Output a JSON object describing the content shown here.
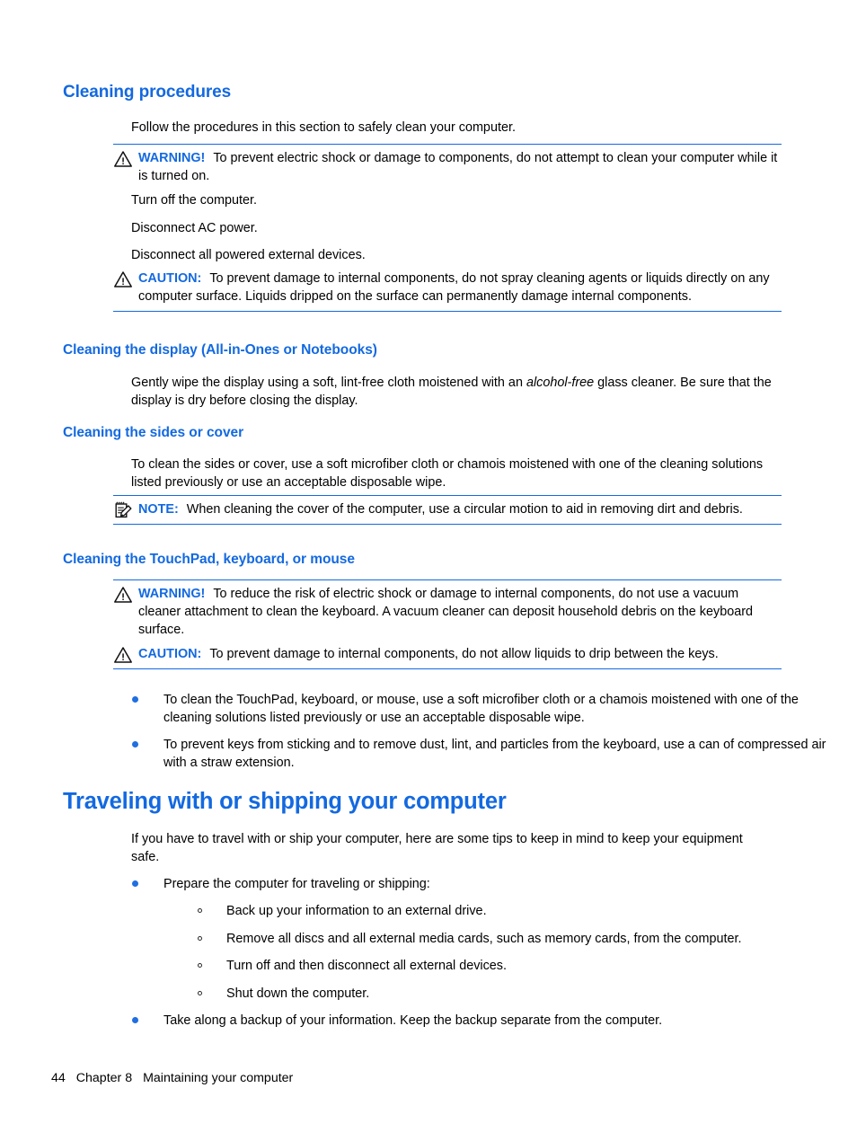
{
  "document": {
    "section_title": "Cleaning procedures",
    "intro": "Follow the procedures in this section to safely clean your computer.",
    "steps": [
      "Turn off the computer.",
      "Disconnect AC power.",
      "Disconnect all powered external devices."
    ],
    "admonitions": {
      "warning_clean": {
        "label": "WARNING!",
        "icon": "warning-triangle-icon",
        "text": "To prevent electric shock or damage to components, do not attempt to clean your computer while it is turned on."
      },
      "caution_spray": {
        "label": "CAUTION:",
        "icon": "caution-triangle-icon",
        "text": "To prevent damage to internal components, do not spray cleaning agents or liquids directly on any computer surface. Liquids dripped on the surface can permanently damage internal components."
      },
      "note_cover": {
        "label": "NOTE:",
        "icon": "note-pad-icon",
        "text": "When cleaning the cover of the computer, use a circular motion to aid in removing dirt and debris."
      },
      "warning_vacuum": {
        "label": "WARNING!",
        "icon": "warning-triangle-icon",
        "text": "To reduce the risk of electric shock or damage to internal components, do not use a vacuum cleaner attachment to clean the keyboard. A vacuum cleaner can deposit household debris on the keyboard surface."
      },
      "caution_keys": {
        "label": "CAUTION:",
        "icon": "caution-triangle-icon",
        "text": "To prevent damage to internal components, do not allow liquids to drip between the keys."
      }
    },
    "subsections": [
      {
        "title": "Cleaning the display (All-in-Ones or Notebooks)",
        "body_before_italic": "Gently wipe the display using a soft, lint-free cloth moistened with an ",
        "italic_phrase": "alcohol-free",
        "body_after_italic": " glass cleaner. Be sure that the display is dry before closing the display."
      },
      {
        "title": "Cleaning the sides or cover",
        "body": "To clean the sides or cover, use a soft microfiber cloth or chamois moistened with one of the cleaning solutions listed previously or use an acceptable disposable wipe."
      },
      {
        "title": "Cleaning the TouchPad, keyboard, or mouse"
      }
    ],
    "touchpad_bullets": [
      "To clean the TouchPad, keyboard, or mouse, use a soft microfiber cloth or a chamois moistened with one of the cleaning solutions listed previously or use an acceptable disposable wipe.",
      "To prevent keys from sticking and to remove dust, lint, and particles from the keyboard, use a can of compressed air with a straw extension."
    ],
    "traveling": {
      "title": "Traveling with or shipping your computer",
      "intro": "If you have to travel with or ship your computer, here are some tips to keep in mind to keep your equipment safe.",
      "bullet_prepare": "Prepare the computer for traveling or shipping:",
      "sub_bullets": [
        "Back up your information to an external drive.",
        "Remove all discs and all external media cards, such as memory cards, from the computer.",
        "Turn off and then disconnect all external devices.",
        "Shut down the computer."
      ],
      "bullet_backup": "Take along a backup of your information. Keep the backup separate from the computer."
    },
    "footer": {
      "page_number": "44",
      "chapter": "Chapter 8",
      "chapter_title": "Maintaining your computer"
    },
    "colors": {
      "heading_blue": "#1369e0",
      "rule_blue": "#1369e0",
      "bullet_blue": "#1f6fe0",
      "text_black": "#000000"
    }
  }
}
